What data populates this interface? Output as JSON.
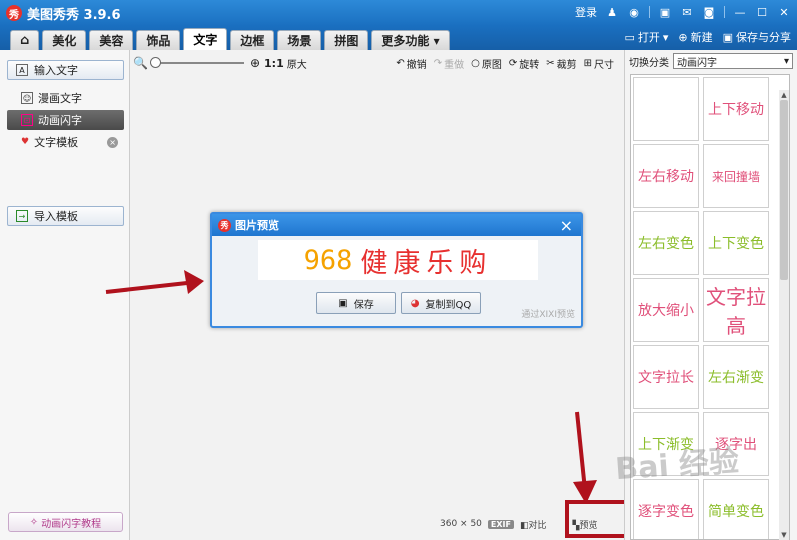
{
  "app": {
    "logo_char": "秀",
    "title": "美图秀秀 3.9.6"
  },
  "titlebar": {
    "login": "登录",
    "icons": [
      "user-icon",
      "weibo-icon",
      "skin-icon",
      "message-icon",
      "settings-icon",
      "minimize-icon",
      "maximize-icon",
      "close-icon"
    ]
  },
  "menu": {
    "tabs": [
      "美化",
      "美容",
      "饰品",
      "文字",
      "边框",
      "场景",
      "拼图"
    ],
    "active_tab": "文字",
    "more": "更多功能",
    "open": "打开",
    "new": "新建",
    "save_share": "保存与分享"
  },
  "left_panel": {
    "input_text": "输入文字",
    "items": [
      "漫画文字",
      "动画闪字",
      "文字模板"
    ],
    "active_item": "动画闪字",
    "import_template": "导入模板",
    "tutorial": "动画闪字教程"
  },
  "toolbar": {
    "zoom_ratio": "1:1",
    "original_size": "原大",
    "undo": "撤销",
    "redo": "重做",
    "original": "原图",
    "rotate": "旋转",
    "crop": "裁剪",
    "resize": "尺寸",
    "slider_value": 0
  },
  "dialog": {
    "title": "图片预览",
    "preview_number": "968",
    "preview_text": "健康乐购",
    "save": "保存",
    "copy_qq": "复制到QQ",
    "hint": "通过XIXI预览"
  },
  "status": {
    "dimensions": "360 × 50",
    "exif": "EXIF",
    "compare": "对比",
    "preview": "预览"
  },
  "right_panel": {
    "category_label": "切换分类",
    "category_value": "动画闪字",
    "effects": [
      {
        "label": "",
        "color": "#e0507a"
      },
      {
        "label": "上下移动",
        "color": "#e0507a"
      },
      {
        "label": "左右移动",
        "color": "#e0507a"
      },
      {
        "label": "来回撞墙",
        "color": "#e0507a"
      },
      {
        "label": "左右变色",
        "color": "#8bbd2a"
      },
      {
        "label": "上下变色",
        "color": "#8bbd2a"
      },
      {
        "label": "放大缩小",
        "color": "#e0507a"
      },
      {
        "label": "文字拉高",
        "color": "#e0507a"
      },
      {
        "label": "文字拉长",
        "color": "#e0507a"
      },
      {
        "label": "左右渐变",
        "color": "#8bbd2a"
      },
      {
        "label": "上下渐变",
        "color": "#8bbd2a"
      },
      {
        "label": "逐字出",
        "color": "#e0507a"
      },
      {
        "label": "逐字变色",
        "color": "#e0507a"
      },
      {
        "label": "简单变色",
        "color": "#8bbd2a"
      }
    ]
  },
  "watermark": "Bai 经验",
  "colors": {
    "titlebar": "#1a6fc0",
    "accent_red": "#b0121d",
    "preview_orange": "#f5a200",
    "preview_red": "#e7302f"
  }
}
